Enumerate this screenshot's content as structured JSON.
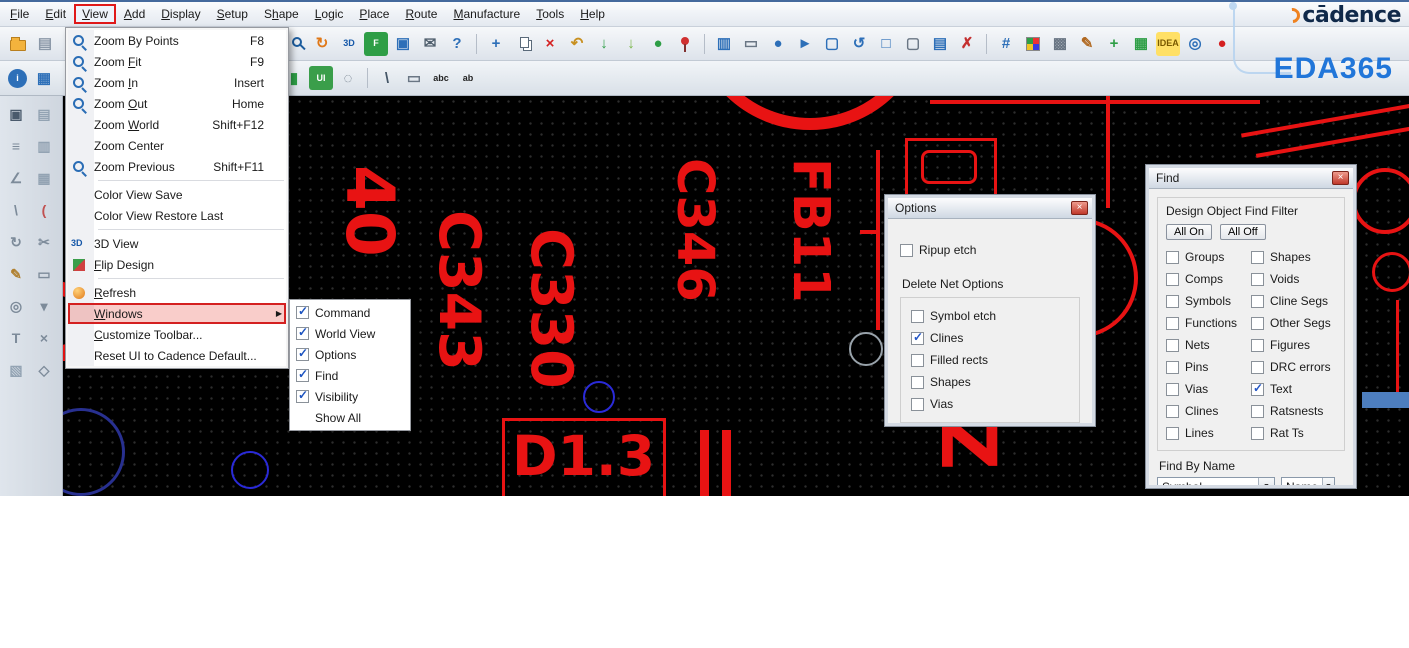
{
  "menu_bar": {
    "items": [
      {
        "name": "menu-file",
        "pre": "",
        "key": "F",
        "post": "ile"
      },
      {
        "name": "menu-edit",
        "pre": "",
        "key": "E",
        "post": "dit"
      },
      {
        "name": "menu-view",
        "pre": "",
        "key": "V",
        "post": "iew",
        "active": true
      },
      {
        "name": "menu-add",
        "pre": "",
        "key": "A",
        "post": "dd"
      },
      {
        "name": "menu-display",
        "pre": "",
        "key": "D",
        "post": "isplay"
      },
      {
        "name": "menu-setup",
        "pre": "",
        "key": "S",
        "post": "etup"
      },
      {
        "name": "menu-shape",
        "pre": "S",
        "key": "h",
        "post": "ape"
      },
      {
        "name": "menu-logic",
        "pre": "",
        "key": "L",
        "post": "ogic"
      },
      {
        "name": "menu-place",
        "pre": "",
        "key": "P",
        "post": "lace"
      },
      {
        "name": "menu-route",
        "pre": "",
        "key": "R",
        "post": "oute"
      },
      {
        "name": "menu-manufacture",
        "pre": "",
        "key": "M",
        "post": "anufacture"
      },
      {
        "name": "menu-tools",
        "pre": "",
        "key": "T",
        "post": "ools"
      },
      {
        "name": "menu-help",
        "pre": "",
        "key": "H",
        "post": "elp"
      }
    ]
  },
  "view_menu": {
    "items": [
      {
        "name": "menu-zoom-by-points",
        "pre": "Zoom By Points",
        "key": "",
        "post": "",
        "shortcut": "F8",
        "icon": "mag"
      },
      {
        "name": "menu-zoom-fit",
        "pre": "Zoom ",
        "key": "F",
        "post": "it",
        "shortcut": "F9",
        "icon": "mag"
      },
      {
        "name": "menu-zoom-in",
        "pre": "Zoom ",
        "key": "I",
        "post": "n",
        "shortcut": "Insert",
        "icon": "mag"
      },
      {
        "name": "menu-zoom-out",
        "pre": "Zoom ",
        "key": "O",
        "post": "ut",
        "shortcut": "Home",
        "icon": "mag"
      },
      {
        "name": "menu-zoom-world",
        "pre": "Zoom ",
        "key": "W",
        "post": "orld",
        "shortcut": "Shift+F12",
        "icon": ""
      },
      {
        "name": "menu-zoom-center",
        "pre": "Zoom Center",
        "key": "",
        "post": "",
        "shortcut": "",
        "icon": ""
      },
      {
        "name": "menu-zoom-previous",
        "pre": "Zoom Previous",
        "key": "",
        "post": "",
        "shortcut": "Shift+F11",
        "icon": "mag"
      },
      {
        "sep": true
      },
      {
        "name": "menu-color-view-save",
        "pre": "Color View Save",
        "key": "",
        "post": "",
        "shortcut": "",
        "icon": ""
      },
      {
        "name": "menu-color-view-restore",
        "pre": "Color View Restore Last",
        "key": "",
        "post": "",
        "shortcut": "",
        "icon": ""
      },
      {
        "sep": true
      },
      {
        "name": "menu-3d-view",
        "pre": "3D View",
        "key": "",
        "post": "",
        "shortcut": "",
        "icon": "3d"
      },
      {
        "name": "menu-flip-design",
        "pre": "",
        "key": "F",
        "post": "lip Design",
        "shortcut": "",
        "icon": "flip"
      },
      {
        "sep": true
      },
      {
        "name": "menu-refresh",
        "pre": "",
        "key": "R",
        "post": "efresh",
        "shortcut": "",
        "icon": "refresh"
      },
      {
        "name": "menu-windows",
        "pre": "",
        "key": "W",
        "post": "indows",
        "shortcut": "",
        "icon": "",
        "highlighted": true,
        "submenu": true
      },
      {
        "name": "menu-customize-toolbar",
        "pre": "",
        "key": "C",
        "post": "ustomize Toolbar...",
        "shortcut": "",
        "icon": ""
      },
      {
        "name": "menu-reset-ui",
        "pre": "Reset UI to Cadence Default...",
        "key": "",
        "post": "",
        "shortcut": "",
        "icon": ""
      }
    ]
  },
  "windows_submenu": {
    "items": [
      {
        "name": "submenu-command",
        "label": "Command",
        "box": true,
        "checked": true
      },
      {
        "name": "submenu-world-view",
        "label": "World View",
        "box": true,
        "checked": true
      },
      {
        "name": "submenu-options",
        "label": "Options",
        "box": true,
        "checked": true
      },
      {
        "name": "submenu-find",
        "label": "Find",
        "box": true,
        "checked": true
      },
      {
        "name": "submenu-visibility",
        "label": "Visibility",
        "box": true,
        "checked": true
      },
      {
        "name": "submenu-show-all",
        "label": "Show All",
        "box": false,
        "checked": false
      }
    ]
  },
  "toolbar1": {
    "left": [
      {
        "name": "open-icon",
        "shape": "folder"
      },
      {
        "name": "plot-icon",
        "glyph": "▤",
        "fg": "#8b98a8"
      }
    ],
    "main": [
      {
        "name": "zoom-rect-icon",
        "shape": "mag"
      },
      {
        "name": "redraw-icon",
        "glyph": "↻",
        "fg": "#e07818"
      },
      {
        "name": "3d-view-icon",
        "glyph": "3D",
        "fg": "#1557a8",
        "small": true
      },
      {
        "name": "flip-design-icon",
        "glyph": "F",
        "fg": "#ffffff",
        "bg": "#2e9e46",
        "small": true
      },
      {
        "name": "cascade-windows-icon",
        "glyph": "▣",
        "fg": "#2d6fb8"
      },
      {
        "name": "mail-icon",
        "glyph": "✉",
        "fg": "#51606e"
      },
      {
        "name": "help-icon",
        "glyph": "?",
        "fg": "#2d6fb8"
      },
      {
        "sep": true
      },
      {
        "name": "move-icon",
        "glyph": "+",
        "fg": "#2d6fb8"
      },
      {
        "name": "copy-icon",
        "shape": "copy"
      },
      {
        "name": "delete-icon",
        "glyph": "×",
        "fg": "#d42020"
      },
      {
        "name": "undo-icon",
        "glyph": "↶",
        "fg": "#c89020"
      },
      {
        "name": "done-icon",
        "glyph": "↓",
        "fg": "#2e9e46"
      },
      {
        "name": "next-icon",
        "glyph": "↓",
        "fg": "#7ab648"
      },
      {
        "name": "world-icon",
        "glyph": "●",
        "fg": "#2e9e46"
      },
      {
        "name": "pin-icon",
        "shape": "pin"
      },
      {
        "sep": true
      },
      {
        "name": "mirror-icon",
        "glyph": "▥",
        "fg": "#2d6fb8"
      },
      {
        "name": "rectangle-icon",
        "glyph": "▭",
        "fg": "#6a7684"
      },
      {
        "name": "circle-icon",
        "glyph": "●",
        "fg": "#2d6fb8"
      },
      {
        "name": "select-icon",
        "glyph": "►",
        "fg": "#2d6fb8"
      },
      {
        "name": "form-icon",
        "glyph": "▢",
        "fg": "#2d6fb8"
      },
      {
        "name": "undo-view-icon",
        "glyph": "↺",
        "fg": "#2d6fb8"
      },
      {
        "name": "window-icon",
        "glyph": "□",
        "fg": "#2d6fb8"
      },
      {
        "name": "frame-icon",
        "glyph": "▢",
        "fg": "#6a7684"
      },
      {
        "name": "notes-icon",
        "glyph": "▤",
        "fg": "#2d6fb8"
      },
      {
        "name": "report-icon",
        "glyph": "✗",
        "fg": "#c43030"
      },
      {
        "sep": true
      },
      {
        "name": "grid-icon",
        "glyph": "#",
        "fg": "#2d6fb8"
      },
      {
        "name": "color-icon",
        "shape": "swatch"
      },
      {
        "name": "shade-icon",
        "glyph": "▩",
        "fg": "#6a7684"
      },
      {
        "name": "brush-icon",
        "glyph": "✎",
        "fg": "#b06820"
      },
      {
        "name": "waive-drc-icon",
        "glyph": "+",
        "fg": "#2e9e46"
      },
      {
        "name": "xsection-icon",
        "glyph": "▦",
        "fg": "#2e9e46"
      },
      {
        "name": "idea-icon",
        "glyph": "IDEA",
        "fg": "#7a5a00",
        "bg": "#ffe066",
        "small": true
      },
      {
        "name": "highlight-icon",
        "glyph": "◎",
        "fg": "#2d6fb8"
      },
      {
        "name": "status-icon",
        "glyph": "●",
        "fg": "#d42020"
      }
    ]
  },
  "toolbar2": {
    "left": [
      {
        "name": "info-icon",
        "glyph": "i",
        "fg": "#ffffff",
        "bg": "#2d6fb8",
        "round": true,
        "small": true
      },
      {
        "name": "properties-icon",
        "glyph": "▦",
        "fg": "#2d6fb8"
      }
    ],
    "main": [
      {
        "name": "visibility-icon",
        "glyph": "▮",
        "fg": "#2e9e46"
      },
      {
        "name": "ui-icon",
        "glyph": "UI",
        "fg": "#ffffff",
        "bg": "#3a9e4a",
        "small": true
      },
      {
        "name": "rats-icon",
        "glyph": "◌",
        "fg": "#6a7684"
      },
      {
        "sep": true
      },
      {
        "name": "line-icon",
        "glyph": "\\",
        "fg": "#445566"
      },
      {
        "name": "rectangle-tool-icon",
        "glyph": "▭",
        "fg": "#6a7684"
      },
      {
        "name": "add-text-icon",
        "glyph": "abc",
        "fg": "#222222",
        "small": true
      },
      {
        "name": "edit-text-icon",
        "glyph": "ab",
        "fg": "#222222",
        "small": true
      }
    ]
  },
  "left_rail": {
    "icons": [
      {
        "name": "lock-icon",
        "glyph": "▣",
        "fg": "#4a5a6c"
      },
      {
        "name": "layers-icon",
        "glyph": "▤",
        "fg": "#93a3b3"
      },
      {
        "name": "measure-icon",
        "glyph": "≡",
        "fg": "#7d8b9a"
      },
      {
        "name": "stack-icon",
        "glyph": "▥",
        "fg": "#93a3b3"
      },
      {
        "name": "angle-icon",
        "glyph": "∠",
        "fg": "#7d8b9a"
      },
      {
        "name": "stack2-icon",
        "glyph": "▦",
        "fg": "#93a3b3"
      },
      {
        "name": "slash-icon",
        "glyph": "\\",
        "fg": "#7d8b9a"
      },
      {
        "name": "arc-icon",
        "glyph": "(",
        "fg": "#c05050"
      },
      {
        "name": "loop-icon",
        "glyph": "↻",
        "fg": "#7d8b9a"
      },
      {
        "name": "cut-icon",
        "glyph": "✂",
        "fg": "#7d8b9a"
      },
      {
        "name": "pencil-icon",
        "glyph": "✎",
        "fg": "#b08030"
      },
      {
        "name": "chip-icon",
        "glyph": "▭",
        "fg": "#7d8b9a"
      },
      {
        "name": "via-icon",
        "glyph": "◎",
        "fg": "#7d8b9a"
      },
      {
        "name": "probe-icon",
        "glyph": "▾",
        "fg": "#7d8b9a"
      },
      {
        "name": "text-tool-icon",
        "glyph": "T",
        "fg": "#7d8b9a"
      },
      {
        "name": "erase-icon",
        "glyph": "×",
        "fg": "#7d8b9a"
      },
      {
        "name": "group-icon",
        "glyph": "▧",
        "fg": "#93a3b3"
      },
      {
        "name": "snap-icon",
        "glyph": "◇",
        "fg": "#7d8b9a"
      }
    ]
  },
  "logo": {
    "cadence": "cādence",
    "eda": "EDA365"
  },
  "options_dialog": {
    "title": "Options",
    "ripup_label": "Ripup etch",
    "group_label": "Delete Net Options",
    "items": [
      {
        "label": "Symbol etch",
        "checked": false
      },
      {
        "label": "Clines",
        "checked": true
      },
      {
        "label": "Filled rects",
        "checked": false
      },
      {
        "label": "Shapes",
        "checked": false
      },
      {
        "label": "Vias",
        "checked": false
      }
    ]
  },
  "find_panel": {
    "title": "Find",
    "filter_label": "Design Object Find Filter",
    "all_on": "All On",
    "all_off": "All Off",
    "left_items": [
      {
        "label": "Groups",
        "checked": false
      },
      {
        "label": "Comps",
        "checked": false
      },
      {
        "label": "Symbols",
        "checked": false
      },
      {
        "label": "Functions",
        "checked": false
      },
      {
        "label": "Nets",
        "checked": false
      },
      {
        "label": "Pins",
        "checked": false
      },
      {
        "label": "Vias",
        "checked": false
      },
      {
        "label": "Clines",
        "checked": false
      },
      {
        "label": "Lines",
        "checked": false
      }
    ],
    "right_items": [
      {
        "label": "Shapes",
        "checked": false
      },
      {
        "label": "Voids",
        "checked": false
      },
      {
        "label": "Cline Segs",
        "checked": false
      },
      {
        "label": "Other Segs",
        "checked": false
      },
      {
        "label": "Figures",
        "checked": false
      },
      {
        "label": "DRC errors",
        "checked": false
      },
      {
        "label": "Text",
        "checked": true
      },
      {
        "label": "Ratsnests",
        "checked": false
      },
      {
        "label": "Rat Ts",
        "checked": false
      }
    ],
    "find_by_name_label": "Find By Name",
    "name_type": "Symbol",
    "name_mode": "Name"
  },
  "canvas": {
    "labels": [
      "40",
      "C343",
      "C330",
      "C346",
      "FB11",
      "D1.3",
      "Z",
      "C"
    ]
  }
}
